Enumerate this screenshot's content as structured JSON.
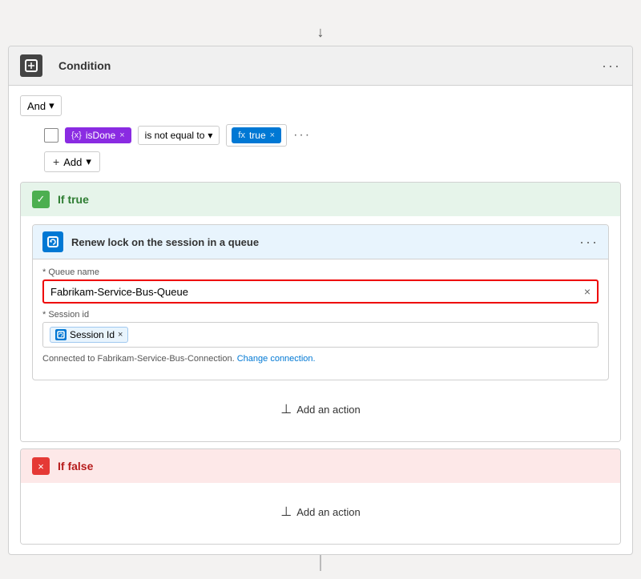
{
  "topArrow": "↓",
  "condition": {
    "headerIcon": "□",
    "title": "Condition",
    "menuLabel": "···",
    "andLabel": "And",
    "chevron": "▾",
    "checkbox": "",
    "isDoneTag": {
      "iconLabel": "{x}",
      "text": "isDone",
      "closeLabel": "×"
    },
    "operatorLabel": "is not equal to",
    "operatorChevron": "▾",
    "trueTag": {
      "iconLabel": "fx",
      "text": "true",
      "closeLabel": "×"
    },
    "ellipsis": "···",
    "addButtonLabel": "Add",
    "addChevron": "▾"
  },
  "ifTrue": {
    "badgeLabel": "✓",
    "label": "If true",
    "action": {
      "iconLabel": "⟳",
      "title": "Renew lock on the session in a queue",
      "menuLabel": "···",
      "queueNameLabel": "* Queue name",
      "queueNameValue": "Fabrikam-Service-Bus-Queue",
      "clearLabel": "×",
      "sessionIdLabel": "* Session id",
      "sessionTagIconLabel": "⟳",
      "sessionTagText": "Session Id",
      "sessionTagClose": "×",
      "connectionText": "Connected to Fabrikam-Service-Bus-Connection.",
      "changeConnectionLabel": "Change connection."
    },
    "addActionLabel": "Add an action"
  },
  "ifFalse": {
    "badgeLabel": "×",
    "label": "If false",
    "addActionLabel": "Add an action"
  },
  "addActionIcon": "⊥"
}
